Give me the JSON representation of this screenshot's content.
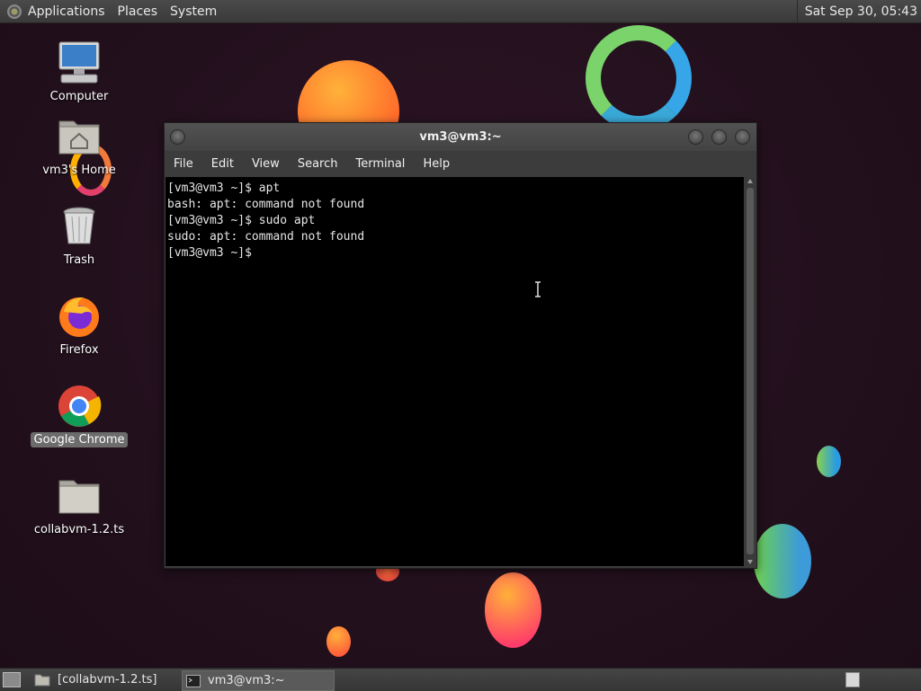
{
  "top_panel": {
    "menus": [
      "Applications",
      "Places",
      "System"
    ],
    "clock": "Sat Sep 30, 05:43",
    "logo_icon": "gnome-foot-icon"
  },
  "desktop": {
    "icons": [
      {
        "label": "Computer",
        "icon": "computer-icon"
      },
      {
        "label": "vm3's Home",
        "icon": "home-folder-icon"
      },
      {
        "label": "Trash",
        "icon": "trash-icon"
      },
      {
        "label": "Firefox",
        "icon": "firefox-icon"
      },
      {
        "label": "Google Chrome",
        "icon": "chrome-icon",
        "selected": true
      },
      {
        "label": "collabvm-1.2.ts",
        "icon": "folder-icon"
      }
    ]
  },
  "terminal": {
    "title": "vm3@vm3:~",
    "menu": [
      "File",
      "Edit",
      "View",
      "Search",
      "Terminal",
      "Help"
    ],
    "lines": [
      "[vm3@vm3 ~]$ apt",
      "bash: apt: command not found",
      "[vm3@vm3 ~]$ sudo apt",
      "sudo: apt: command not found",
      "[vm3@vm3 ~]$ "
    ]
  },
  "taskbar": {
    "show_desktop_icon": "show-desktop-icon",
    "tasks": [
      {
        "label": "[collabvm-1.2.ts]",
        "icon": "folder-icon",
        "active": false
      },
      {
        "label": "vm3@vm3:~",
        "icon": "terminal-icon",
        "active": true
      }
    ],
    "workspace_icon": "workspace-switcher-icon"
  },
  "colors": {
    "desktop_bg": "#25111f",
    "panel_bg": "#3c3c3c",
    "terminal_bg": "#000000",
    "terminal_fg": "#e6e6e6"
  }
}
